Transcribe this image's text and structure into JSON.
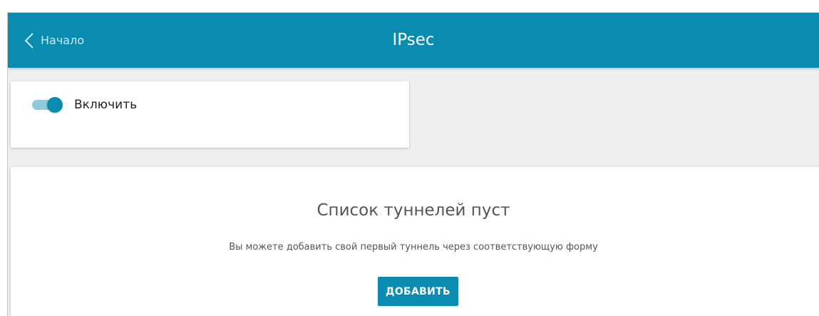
{
  "header": {
    "back_label": "Начало",
    "title": "IPsec"
  },
  "enable": {
    "label": "Включить",
    "state": "on"
  },
  "tunnels": {
    "empty_title": "Список туннелей пуст",
    "empty_description": "Вы можете добавить свой первый туннель через соответствующую форму",
    "add_button_label": "ДОБАВИТЬ"
  },
  "colors": {
    "accent": "#0a8cb0",
    "page_background": "#efefef",
    "toggle_track": "#8fc9dc"
  },
  "icons": {
    "back": "chevron-left-icon"
  }
}
